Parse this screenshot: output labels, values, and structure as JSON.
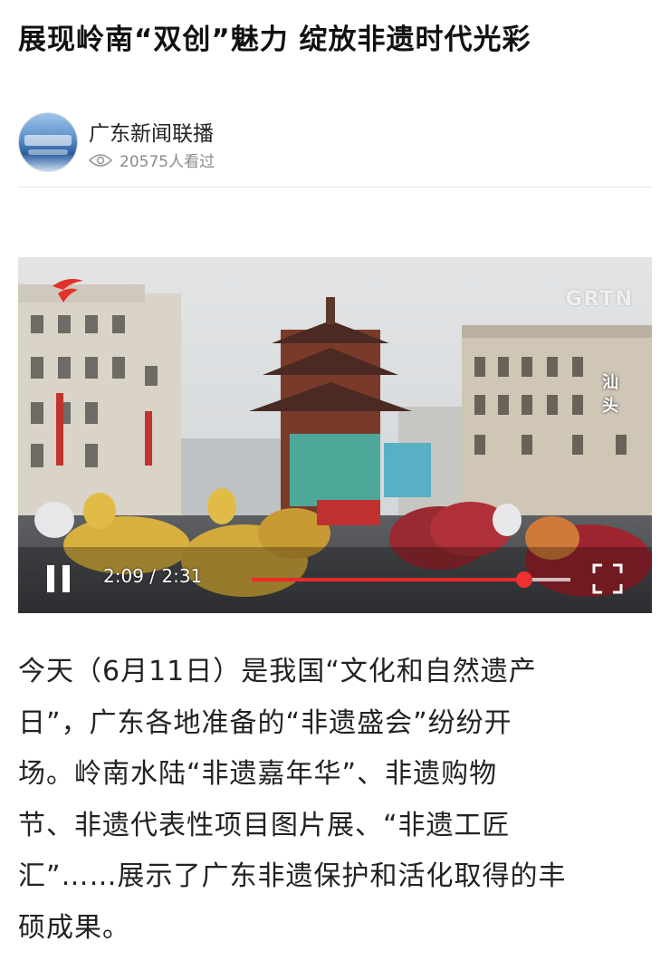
{
  "article": {
    "title": "展现岭南“双创”魅力 绽放非遗时代光彩"
  },
  "author": {
    "name": "广东新闻联播",
    "avatar_icon": "broadcast-logo",
    "views": "20575人看过",
    "views_icon": "eye-icon"
  },
  "video": {
    "watermark": "GRTN",
    "brand_icon": "station-logo",
    "location_caption": "汕头",
    "time": "2:09 / 2:31",
    "current_seconds": 129,
    "total_seconds": 151,
    "play_state_icon": "pause-icon",
    "fullscreen_icon": "fullscreen-icon",
    "accent_color": "#ee2a2a"
  },
  "body": {
    "lines": [
      "今天（6月11日）是我国“文化和自然遗产",
      "日”，广东各地准备的“非遗盛会”纷纷开",
      "场。岭南水陆“非遗嘉年华”、非遗购物",
      "节、非遗代表性项目图片展、“非遗工匠",
      "汇”……展示了广东非遗保护和活化取得的丰",
      "硕成果。"
    ]
  }
}
